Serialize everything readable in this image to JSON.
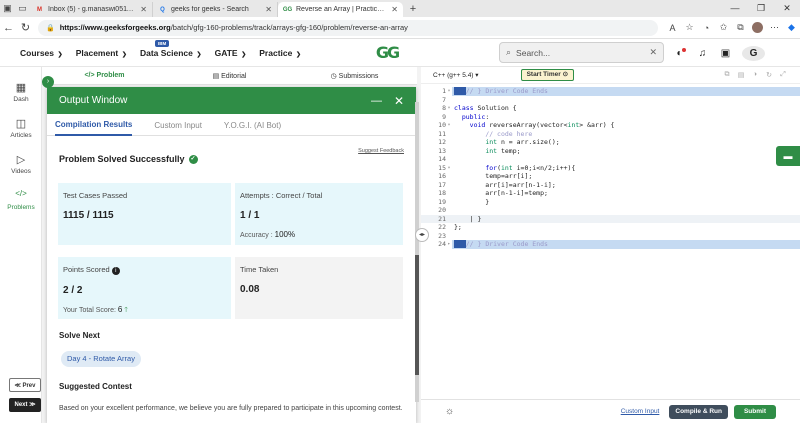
{
  "browser": {
    "tabs": [
      {
        "favicon": "M",
        "favicon_color": "#d93025",
        "title": "Inbox (5) - g.manaswi0511@gm..."
      },
      {
        "favicon": "Q",
        "favicon_color": "#1a73e8",
        "title": "geeks for geeks - Search"
      },
      {
        "favicon": "GG",
        "favicon_color": "#2f8d46",
        "title": "Reverse an Array | Practice | Geek..."
      }
    ],
    "new_tab": "+",
    "url_host": "https://www.geeksforgeeks.org",
    "url_path": "/batch/gfg-160-problems/track/arrays-gfg-160/problem/reverse-an-array"
  },
  "nav": {
    "menu": [
      {
        "label": "Courses",
        "badge": ""
      },
      {
        "label": "Placement",
        "badge": ""
      },
      {
        "label": "Data Science",
        "badge": "IBM"
      },
      {
        "label": "GATE",
        "badge": ""
      },
      {
        "label": "Practice",
        "badge": ""
      }
    ],
    "logo": "GG",
    "search_placeholder": "Search...",
    "avatar_letter": "G"
  },
  "rail": {
    "items": [
      {
        "icon": "dashboard-icon",
        "glyph": "▦",
        "label": "Dash"
      },
      {
        "icon": "articles-icon",
        "glyph": "◫",
        "label": "Articles"
      },
      {
        "icon": "videos-icon",
        "glyph": "▷",
        "label": "Videos"
      },
      {
        "icon": "problems-icon",
        "glyph": "</>",
        "label": "Problems"
      }
    ],
    "prev": "≪ Prev",
    "next": "Next ≫"
  },
  "problem_tabs": [
    "</> Problem",
    "▤ Editorial",
    "◷ Submissions"
  ],
  "output": {
    "title": "Output Window",
    "tabs": [
      "Compilation Results",
      "Custom Input",
      "Y.O.G.I. (AI Bot)"
    ],
    "status": "Problem Solved Successfully",
    "feedback": "Suggest Feedback",
    "stats": {
      "tests_label": "Test Cases Passed",
      "tests_value": "1115 / 1115",
      "attempts_label": "Attempts : Correct / Total",
      "attempts_value": "1 / 1",
      "accuracy_label": "Accuracy :",
      "accuracy_value": "100%",
      "points_label": "Points Scored",
      "points_value": "2 / 2",
      "total_label": "Your Total Score:",
      "total_value": "6",
      "time_label": "Time Taken",
      "time_value": "0.08"
    },
    "solve_next": "Solve Next",
    "next_problem": "Day 4 - Rotate Array",
    "suggested_contest": "Suggested Contest",
    "contest_text": "Based on your excellent performance, we believe you are fully prepared to participate in this upcoming contest."
  },
  "editor": {
    "language": "C++ (g++ 5.4)",
    "timer": "Start Timer",
    "lines": [
      {
        "n": "1",
        "fold": "▾",
        "hl": true,
        "html": "<span class='sel'>▇▇▇</span><span class='cm'>// } Driver Code Ends</span>"
      },
      {
        "n": "7",
        "fold": "",
        "html": ""
      },
      {
        "n": "8",
        "fold": "▾",
        "html": "<span class='kw'>class</span> Solution {"
      },
      {
        "n": "9",
        "fold": "",
        "html": "  <span class='kw'>public</span>:"
      },
      {
        "n": "10",
        "fold": "▾",
        "html": "    <span class='kw'>void</span> reverseArray(vector&lt;<span class='ty'>int</span>&gt; &amp;arr) {"
      },
      {
        "n": "11",
        "fold": "",
        "html": "        <span class='cm'>// code here</span>"
      },
      {
        "n": "12",
        "fold": "",
        "html": "        <span class='ty'>int</span> n = arr.size();"
      },
      {
        "n": "13",
        "fold": "",
        "html": "        <span class='ty'>int</span> temp;"
      },
      {
        "n": "14",
        "fold": "",
        "html": ""
      },
      {
        "n": "15",
        "fold": "▾",
        "html": "        <span class='kw'>for</span>(<span class='ty'>int</span> i=0;i&lt;n/2;i++){"
      },
      {
        "n": "16",
        "fold": "",
        "html": "        temp=arr[i];"
      },
      {
        "n": "17",
        "fold": "",
        "html": "        arr[i]=arr[n-1-i];"
      },
      {
        "n": "18",
        "fold": "",
        "html": "        arr[n-1-i]=temp;"
      },
      {
        "n": "19",
        "fold": "",
        "html": "        }"
      },
      {
        "n": "20",
        "fold": "",
        "html": ""
      },
      {
        "n": "21",
        "fold": "",
        "cur": true,
        "html": "    | }"
      },
      {
        "n": "22",
        "fold": "",
        "html": "};"
      },
      {
        "n": "23",
        "fold": "",
        "html": ""
      },
      {
        "n": "24",
        "fold": "▸",
        "hl": true,
        "html": "<span class='sel'>▇▇▇</span><span class='cm'>// } Driver Code Ends</span>"
      }
    ],
    "custom_input": "Custom Input",
    "compile": "Compile & Run",
    "submit": "Submit"
  }
}
